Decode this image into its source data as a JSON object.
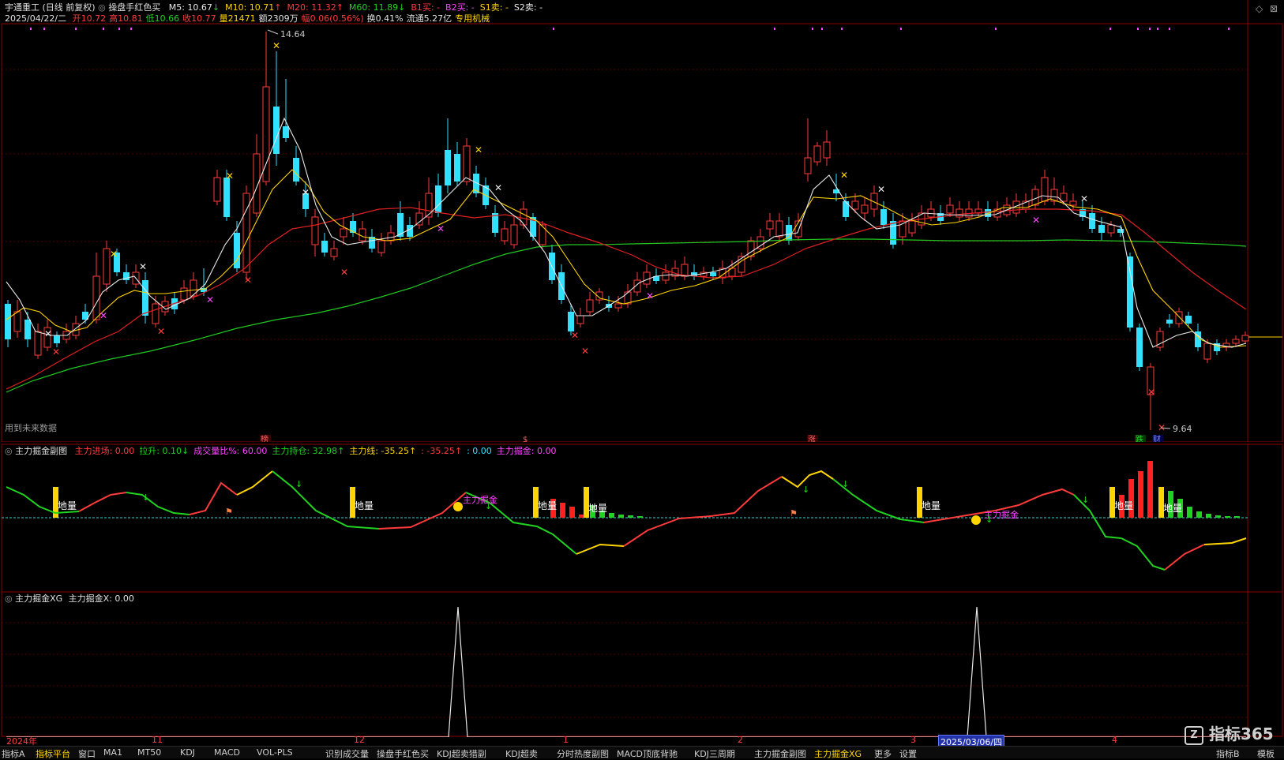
{
  "header": {
    "stock_name": "宇通重工",
    "period": "(日线 前复权)",
    "indicator_name": "操盘手红色买",
    "ma_values": [
      {
        "label": "M5: 10.67",
        "arrow": "↓",
        "color": "#e8e8e8"
      },
      {
        "label": "M10: 10.71",
        "arrow": "↑",
        "color": "#ffd400"
      },
      {
        "label": "M20: 11.32",
        "arrow": "↑",
        "color": "#ff3b3b"
      },
      {
        "label": "M60: 11.89",
        "arrow": "↓",
        "color": "#21d321"
      },
      {
        "label": "B1买: -",
        "arrow": "",
        "color": "#ff3b3b"
      },
      {
        "label": "B2买: -",
        "arrow": "",
        "color": "#ff44ff"
      },
      {
        "label": "S1卖: -",
        "arrow": "",
        "color": "#ffd400"
      },
      {
        "label": "S2卖: -",
        "arrow": "",
        "color": "#e8e8e8"
      }
    ],
    "quote_date": "2025/04/22/二",
    "quote_items": [
      {
        "label": "开10.72",
        "color": "#ff3b3b"
      },
      {
        "label": "高10.81",
        "color": "#ff3b3b"
      },
      {
        "label": "低10.66",
        "color": "#21d321"
      },
      {
        "label": "收10.77",
        "color": "#ff3b3b"
      },
      {
        "label": "量21471",
        "color": "#ffd400"
      },
      {
        "label": "额2309万",
        "color": "#e0e0e0"
      },
      {
        "label": "幅0.06(0.56%)",
        "color": "#ff3b3b"
      },
      {
        "label": "换0.41%",
        "color": "#e0e0e0"
      },
      {
        "label": "流通5.27亿",
        "color": "#e0e0e0"
      },
      {
        "label": "专用机械",
        "color": "#ffd400"
      }
    ],
    "future_data_note": "用到未来数据"
  },
  "price_chart": {
    "high_label": "14.64",
    "low_label": "9.64",
    "event_markers": [
      "榜",
      "$",
      "涨",
      "跌",
      "财"
    ]
  },
  "sub1": {
    "title": "主力掘金副图",
    "values": [
      {
        "label": "主力进场: 0.00",
        "color": "#ff3b3b"
      },
      {
        "label": "拉升: 0.10↓",
        "color": "#21d321"
      },
      {
        "label": "成交量比%: 60.00",
        "color": "#ff44ff"
      },
      {
        "label": "主力持仓: 32.98↑",
        "color": "#21d321"
      },
      {
        "label": "主力线: -35.25↑",
        "color": "#ffd400"
      },
      {
        "label": ": -35.25↑",
        "color": "#ff3b3b"
      },
      {
        "label": ": 0.00",
        "color": "#33e0ff"
      },
      {
        "label": "主力掘金: 0.00",
        "color": "#ff44ff"
      }
    ],
    "diliang_label": "地量",
    "zljj_label": "主力掘金"
  },
  "sub2": {
    "title": "主力掘金XG",
    "value_label": "主力掘金X: 0.00"
  },
  "date_axis": [
    {
      "label": "2024年",
      "sel": false
    },
    {
      "label": "11",
      "sel": false
    },
    {
      "label": "12",
      "sel": false
    },
    {
      "label": "1",
      "sel": false
    },
    {
      "label": "2",
      "sel": false
    },
    {
      "label": "3",
      "sel": false
    },
    {
      "label": "2025/03/06/四",
      "sel": true
    },
    {
      "label": "4",
      "sel": false
    }
  ],
  "tabs": [
    {
      "label": "指标A",
      "active": false
    },
    {
      "label": "指标平台",
      "active": true
    },
    {
      "label": "窗口",
      "active": false
    },
    {
      "label": "MA1",
      "active": false
    },
    {
      "label": "MT50",
      "active": false
    },
    {
      "label": "KDJ",
      "active": false
    },
    {
      "label": "MACD",
      "active": false
    },
    {
      "label": "VOL-PLS",
      "active": false
    },
    {
      "label": "识别成交量",
      "active": false
    },
    {
      "label": "操盘手红色买",
      "active": false
    },
    {
      "label": "KDJ超卖猎副",
      "active": false
    },
    {
      "label": "KDJ超卖",
      "active": false
    },
    {
      "label": "分时热度副图",
      "active": false
    },
    {
      "label": "MACD顶底背驰",
      "active": false
    },
    {
      "label": "KDJ三周期",
      "active": false
    },
    {
      "label": "主力掘金副图",
      "active": false
    },
    {
      "label": "主力掘金XG",
      "active": true
    },
    {
      "label": "更多",
      "active": false
    },
    {
      "label": "设置",
      "active": false
    },
    {
      "label": "指标B",
      "active": false
    },
    {
      "label": "模板",
      "active": false
    }
  ],
  "watermark": "指标365",
  "colors": {
    "up": "#ff3b3b",
    "down": "#33e0ff",
    "ma5": "#e8e8e8",
    "ma10": "#ffd400",
    "ma20": "#e02020",
    "ma60": "#21c821",
    "grid": "#8b0000"
  }
}
